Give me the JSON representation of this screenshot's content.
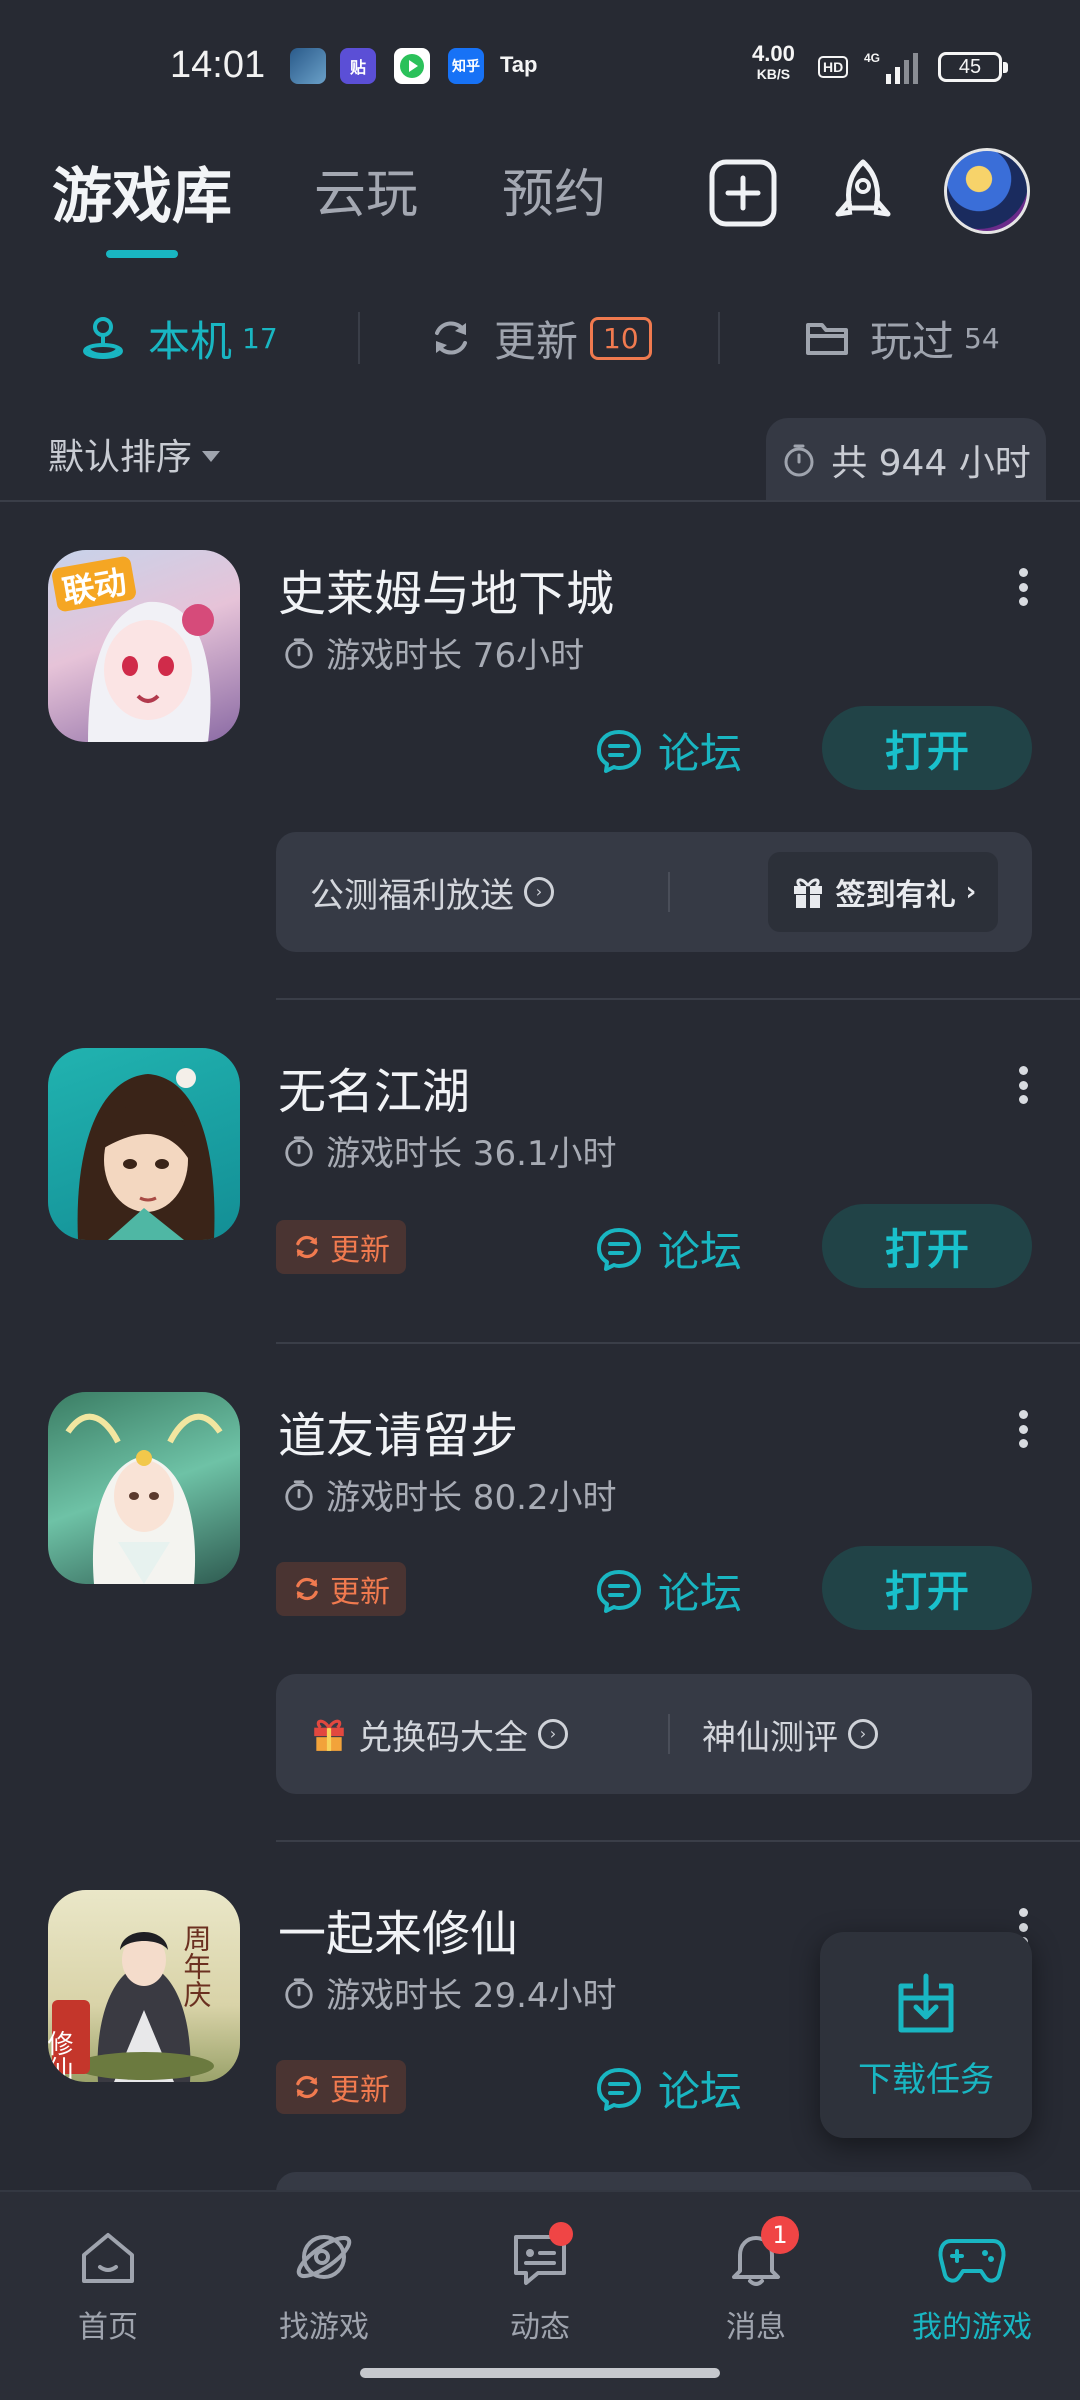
{
  "status_bar": {
    "time": "14:01",
    "notification_icons": [
      "game-app-icon",
      "tieba-icon",
      "video-app-icon",
      "zhihu-icon"
    ],
    "zhihu_label": "知乎",
    "tieba_label": "贴",
    "tap_label": "Tap",
    "net_speed": "4.00",
    "net_unit": "KB/S",
    "hd_label": "HD",
    "network": "4G",
    "battery": "45"
  },
  "header": {
    "tabs": [
      {
        "label": "游戏库",
        "active": true
      },
      {
        "label": "云玩",
        "active": false
      },
      {
        "label": "预约",
        "active": false
      }
    ],
    "icons": [
      "add-icon",
      "rocket-icon",
      "avatar"
    ]
  },
  "filters": [
    {
      "label": "本机",
      "count": "17",
      "icon": "device-icon",
      "active": true
    },
    {
      "label": "更新",
      "count": "10",
      "icon": "refresh-icon",
      "active": false
    },
    {
      "label": "玩过",
      "count": "54",
      "icon": "folder-icon",
      "active": false
    }
  ],
  "sort": {
    "label": "默认排序"
  },
  "total_time": {
    "label": "共 944 小时"
  },
  "games": [
    {
      "name": "史莱姆与地下城",
      "playtime": "游戏时长 76小时",
      "forum": "论坛",
      "open": "打开",
      "icon_text": "联动",
      "promo": {
        "left": "公测福利放送",
        "right": "签到有礼"
      }
    },
    {
      "name": "无名江湖",
      "playtime": "游戏时长 36.1小时",
      "forum": "论坛",
      "open": "打开",
      "update": "更新"
    },
    {
      "name": "道友请留步",
      "playtime": "游戏时长 80.2小时",
      "forum": "论坛",
      "open": "打开",
      "update": "更新",
      "promo": {
        "left": "兑换码大全",
        "right": "神仙测评"
      }
    },
    {
      "name": "一起来修仙",
      "playtime": "游戏时长 29.4小时",
      "forum": "论坛",
      "update": "更新",
      "icon_text": "周年庆",
      "icon_text2": "修仙"
    }
  ],
  "download_task": {
    "label": "下载任务"
  },
  "bottom_nav": [
    {
      "label": "首页",
      "icon": "home-icon"
    },
    {
      "label": "找游戏",
      "icon": "planet-icon"
    },
    {
      "label": "动态",
      "icon": "chat-icon",
      "dot": true
    },
    {
      "label": "消息",
      "icon": "bell-icon",
      "badge": "1"
    },
    {
      "label": "我的游戏",
      "icon": "gamepad-icon",
      "active": true
    }
  ],
  "colors": {
    "background": "#272a33",
    "accent": "#19b6c2",
    "update_orange": "#f07a4f",
    "badge_red": "#f04545"
  }
}
